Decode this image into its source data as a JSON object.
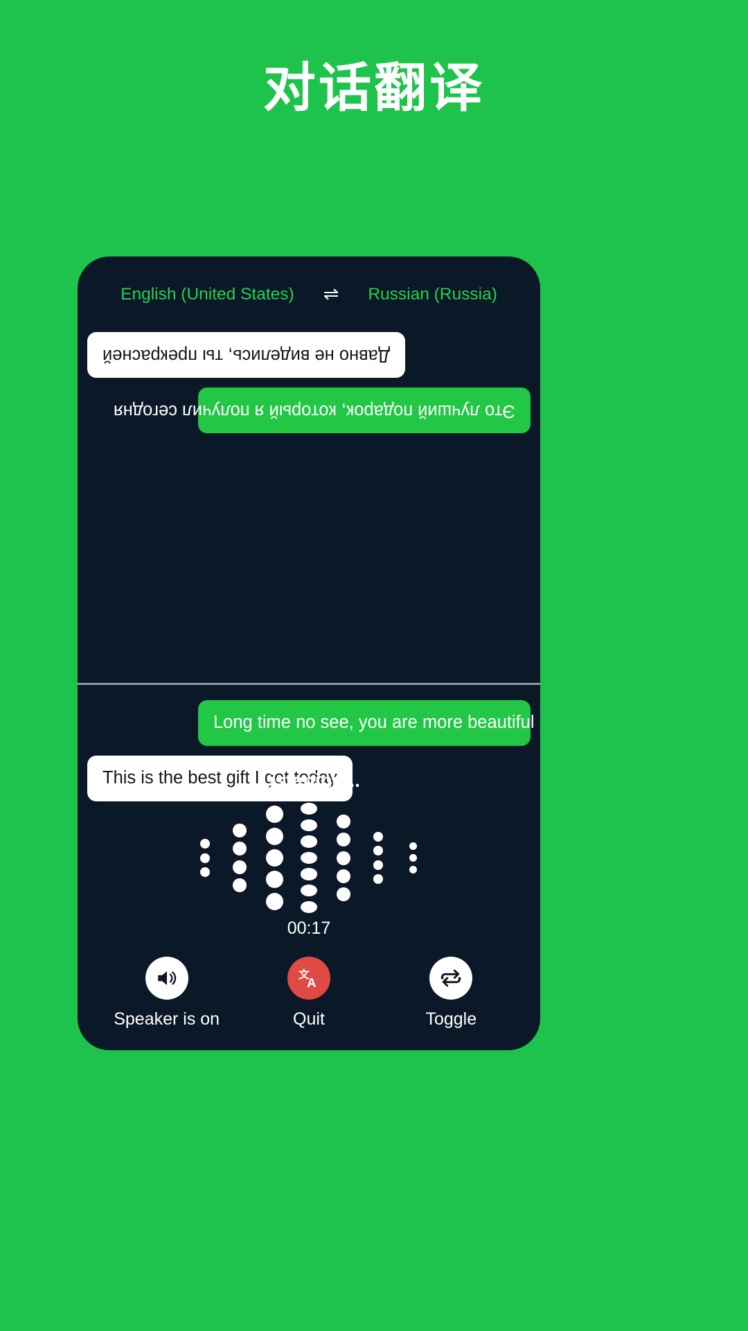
{
  "page": {
    "title": "对话翻译",
    "background_color": "#1ec34b"
  },
  "card": {
    "background_color": "#0b1827"
  },
  "language_bar": {
    "source_language": "English (United States)",
    "target_language": "Russian (Russia)",
    "swap_icon": "swap-horizontal-icon",
    "swap_glyph": "⇌",
    "language_color": "#22d34f"
  },
  "conversation": {
    "remote_pane": {
      "rotated_180": true,
      "messages": [
        {
          "text": "Это лучший подарок, который я получил сегодня",
          "style": "green",
          "align": "left",
          "language": "Russian (Russia)"
        },
        {
          "text": "Давно не виделись, ты прекрасней",
          "style": "white",
          "align": "right",
          "language": "Russian (Russia)"
        }
      ]
    },
    "local_pane": {
      "rotated_180": false,
      "messages": [
        {
          "text": "Long time no see, you are more beautiful",
          "style": "green",
          "align": "right",
          "language": "English (United States)"
        },
        {
          "text": "This is the best gift I got today",
          "style": "white",
          "align": "left",
          "language": "English (United States)"
        }
      ]
    },
    "bubble_green_color": "#22c745",
    "bubble_white_color": "#ffffff"
  },
  "listening": {
    "status_text": "Listening...",
    "timer": "00:17",
    "waveform": {
      "dot_color": "#ffffff",
      "columns": [
        {
          "count": 3,
          "size": 14
        },
        {
          "count": 4,
          "size": 20
        },
        {
          "count": 5,
          "size": 25
        },
        {
          "count": 7,
          "size": 24
        },
        {
          "count": 5,
          "size": 20
        },
        {
          "count": 4,
          "size": 14
        },
        {
          "count": 3,
          "size": 11
        }
      ]
    }
  },
  "controls": [
    {
      "id": "speaker",
      "label": "Speaker is on",
      "icon": "speaker-on-icon",
      "circle_style": "white",
      "circle_color": "#ffffff"
    },
    {
      "id": "quit",
      "label": "Quit",
      "icon": "translate-icon",
      "circle_style": "red",
      "circle_color": "#e04a45"
    },
    {
      "id": "toggle",
      "label": "Toggle",
      "icon": "repeat-swap-icon",
      "circle_style": "white",
      "circle_color": "#ffffff"
    }
  ]
}
